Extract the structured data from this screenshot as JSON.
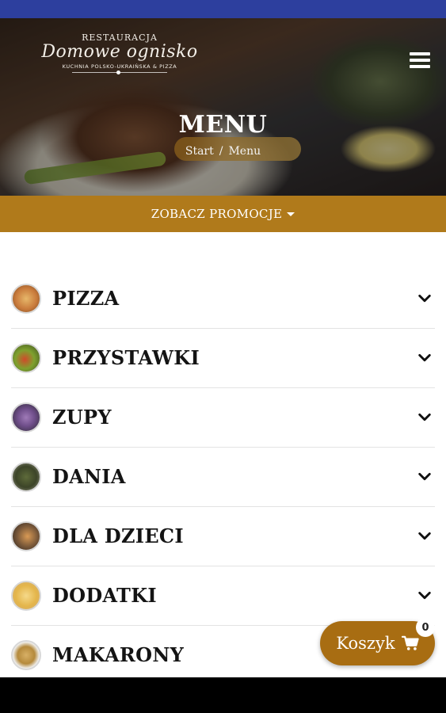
{
  "header": {
    "logo": {
      "top": "RESTAURACJA",
      "name": "Domowe ognisko",
      "subtitle": "KUCHNIA POLSKO-UKRAIŃSKA & PIZZA"
    },
    "menu_icon": "hamburger-icon"
  },
  "hero": {
    "title": "MENU",
    "breadcrumb": {
      "start": "Start",
      "separator": "/",
      "current": "Menu"
    }
  },
  "promo": {
    "label": "ZOBACZ PROMOCJE",
    "icon": "caret-down-icon"
  },
  "categories": [
    {
      "label": "PIZZA"
    },
    {
      "label": "PRZYSTAWKI"
    },
    {
      "label": "ZUPY"
    },
    {
      "label": "DANIA"
    },
    {
      "label": "DLA DZIECI"
    },
    {
      "label": "DODATKI"
    },
    {
      "label": "MAKARONY"
    }
  ],
  "cart": {
    "label": "Koszyk",
    "count": "0",
    "icon": "cart-icon"
  },
  "colors": {
    "status_bar": "#2d3f9e",
    "accent": "#b07a1b",
    "cart": "#a86d12"
  }
}
